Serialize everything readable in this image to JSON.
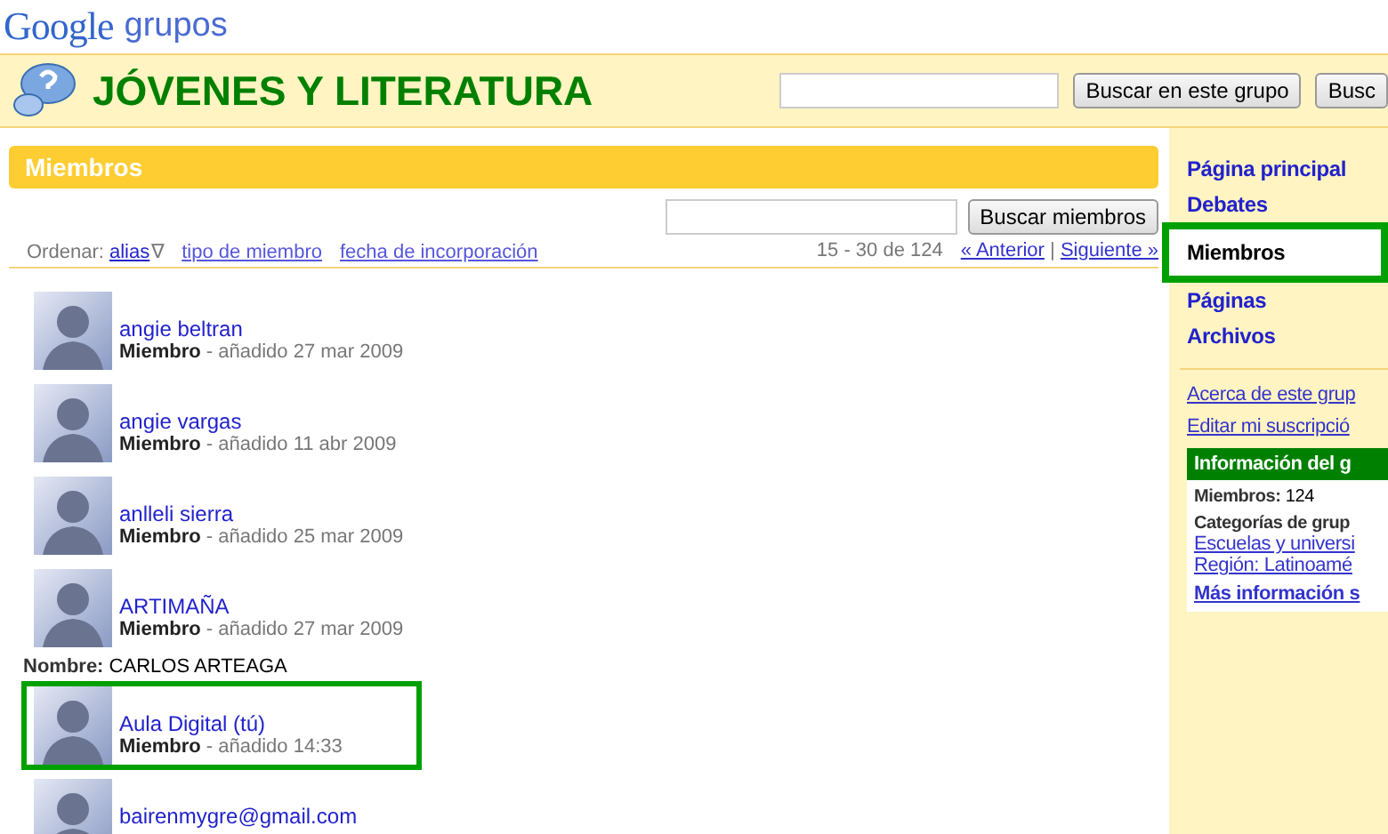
{
  "logo": {
    "brand": "Google",
    "product": "grupos"
  },
  "group": {
    "title": "JÓVENES Y LITERATURA"
  },
  "group_search": {
    "buttons": [
      "Buscar en este grupo",
      "Busc"
    ]
  },
  "panel": {
    "title": "Miembros",
    "search_button": "Buscar miembros",
    "sort": {
      "label": "Ordenar:",
      "options": [
        {
          "label": "alias",
          "selected": true,
          "indicator": "∇"
        },
        {
          "label": "tipo de miembro",
          "selected": false
        },
        {
          "label": "fecha de incorporación",
          "selected": false
        }
      ]
    },
    "range": "15 - 30 de 124",
    "prev": "« Anterior",
    "separator": "|",
    "next": "Siguiente »"
  },
  "members": [
    {
      "name": "angie beltran",
      "role": "Miembro",
      "added": "- añadido 27 mar 2009",
      "highlighted": false
    },
    {
      "name": "angie vargas",
      "role": "Miembro",
      "added": "- añadido 11 abr 2009",
      "highlighted": false
    },
    {
      "name": "anlleli sierra",
      "role": "Miembro",
      "added": "- añadido 25 mar 2009",
      "highlighted": false
    },
    {
      "name": "ARTIMAÑA",
      "role": "Miembro",
      "added": "- añadido 27 mar 2009",
      "highlighted": false,
      "real_name_label": "Nombre:",
      "real_name": "CARLOS ARTEAGA"
    },
    {
      "name": "Aula Digital (tú)",
      "role": "Miembro",
      "added": "- añadido 14:33",
      "highlighted": true
    },
    {
      "name": "bairenmygre@gmail.com",
      "highlighted": false
    }
  ],
  "sidebar": {
    "nav": [
      {
        "label": "Página principal",
        "selected": false
      },
      {
        "label": "Debates",
        "selected": false
      },
      {
        "label": "Miembros",
        "selected": true
      },
      {
        "label": "Páginas",
        "selected": false
      },
      {
        "label": "Archivos",
        "selected": false
      }
    ],
    "links": [
      "Acerca de este grup",
      "Editar mi suscripció"
    ],
    "info": {
      "title": "Información del g",
      "members_label": "Miembros:",
      "members_count": "124",
      "categories_label": "Categorías de grup",
      "category_links": [
        "Escuelas y universi",
        "Región: Latinoamé"
      ],
      "more": "Más información s"
    }
  }
}
